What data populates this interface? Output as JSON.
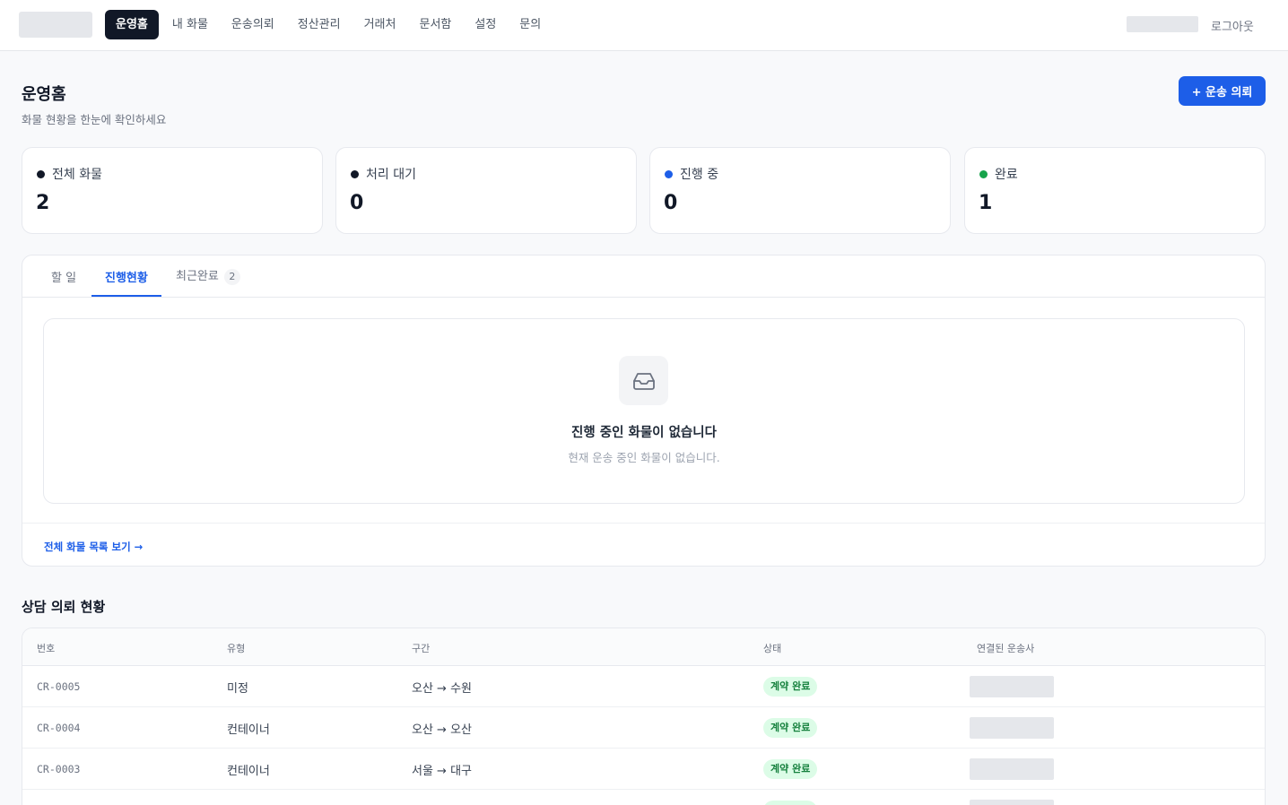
{
  "nav": {
    "items": [
      "운영홈",
      "내 화물",
      "운송의뢰",
      "정산관리",
      "거래처",
      "문서함",
      "설정",
      "문의"
    ],
    "logout": "로그아웃"
  },
  "header": {
    "title": "운영홈",
    "subtitle": "화물 현황을 한눈에 확인하세요",
    "new_request": "+ 운송 의뢰"
  },
  "stats": [
    {
      "label": "전체 화물",
      "value": "2",
      "color": "#111827"
    },
    {
      "label": "처리 대기",
      "value": "0",
      "color": "#111827"
    },
    {
      "label": "진행 중",
      "value": "0",
      "color": "#1d5ee8"
    },
    {
      "label": "완료",
      "value": "1",
      "color": "#16a34a"
    }
  ],
  "tabs": [
    {
      "label": "할 일"
    },
    {
      "label": "진행현황"
    },
    {
      "label": "최근완료",
      "count": "2"
    }
  ],
  "empty": {
    "icon": "inbox-icon",
    "title": "진행 중인 화물이 없습니다",
    "desc": "현재 운송 중인 화물이 없습니다."
  },
  "view_all": "전체 화물 목록 보기 →",
  "consult": {
    "title": "상담 의뢰 현황",
    "columns": [
      "번호",
      "유형",
      "구간",
      "상태",
      "연결된 운송사"
    ],
    "rows": [
      {
        "id": "CR-0005",
        "type": "미정",
        "route": "오산 → 수원",
        "status": "계약 완료"
      },
      {
        "id": "CR-0004",
        "type": "컨테이너",
        "route": "오산 → 오산",
        "status": "계약 완료"
      },
      {
        "id": "CR-0003",
        "type": "컨테이너",
        "route": "서울 → 대구",
        "status": "계약 완료"
      }
    ]
  }
}
